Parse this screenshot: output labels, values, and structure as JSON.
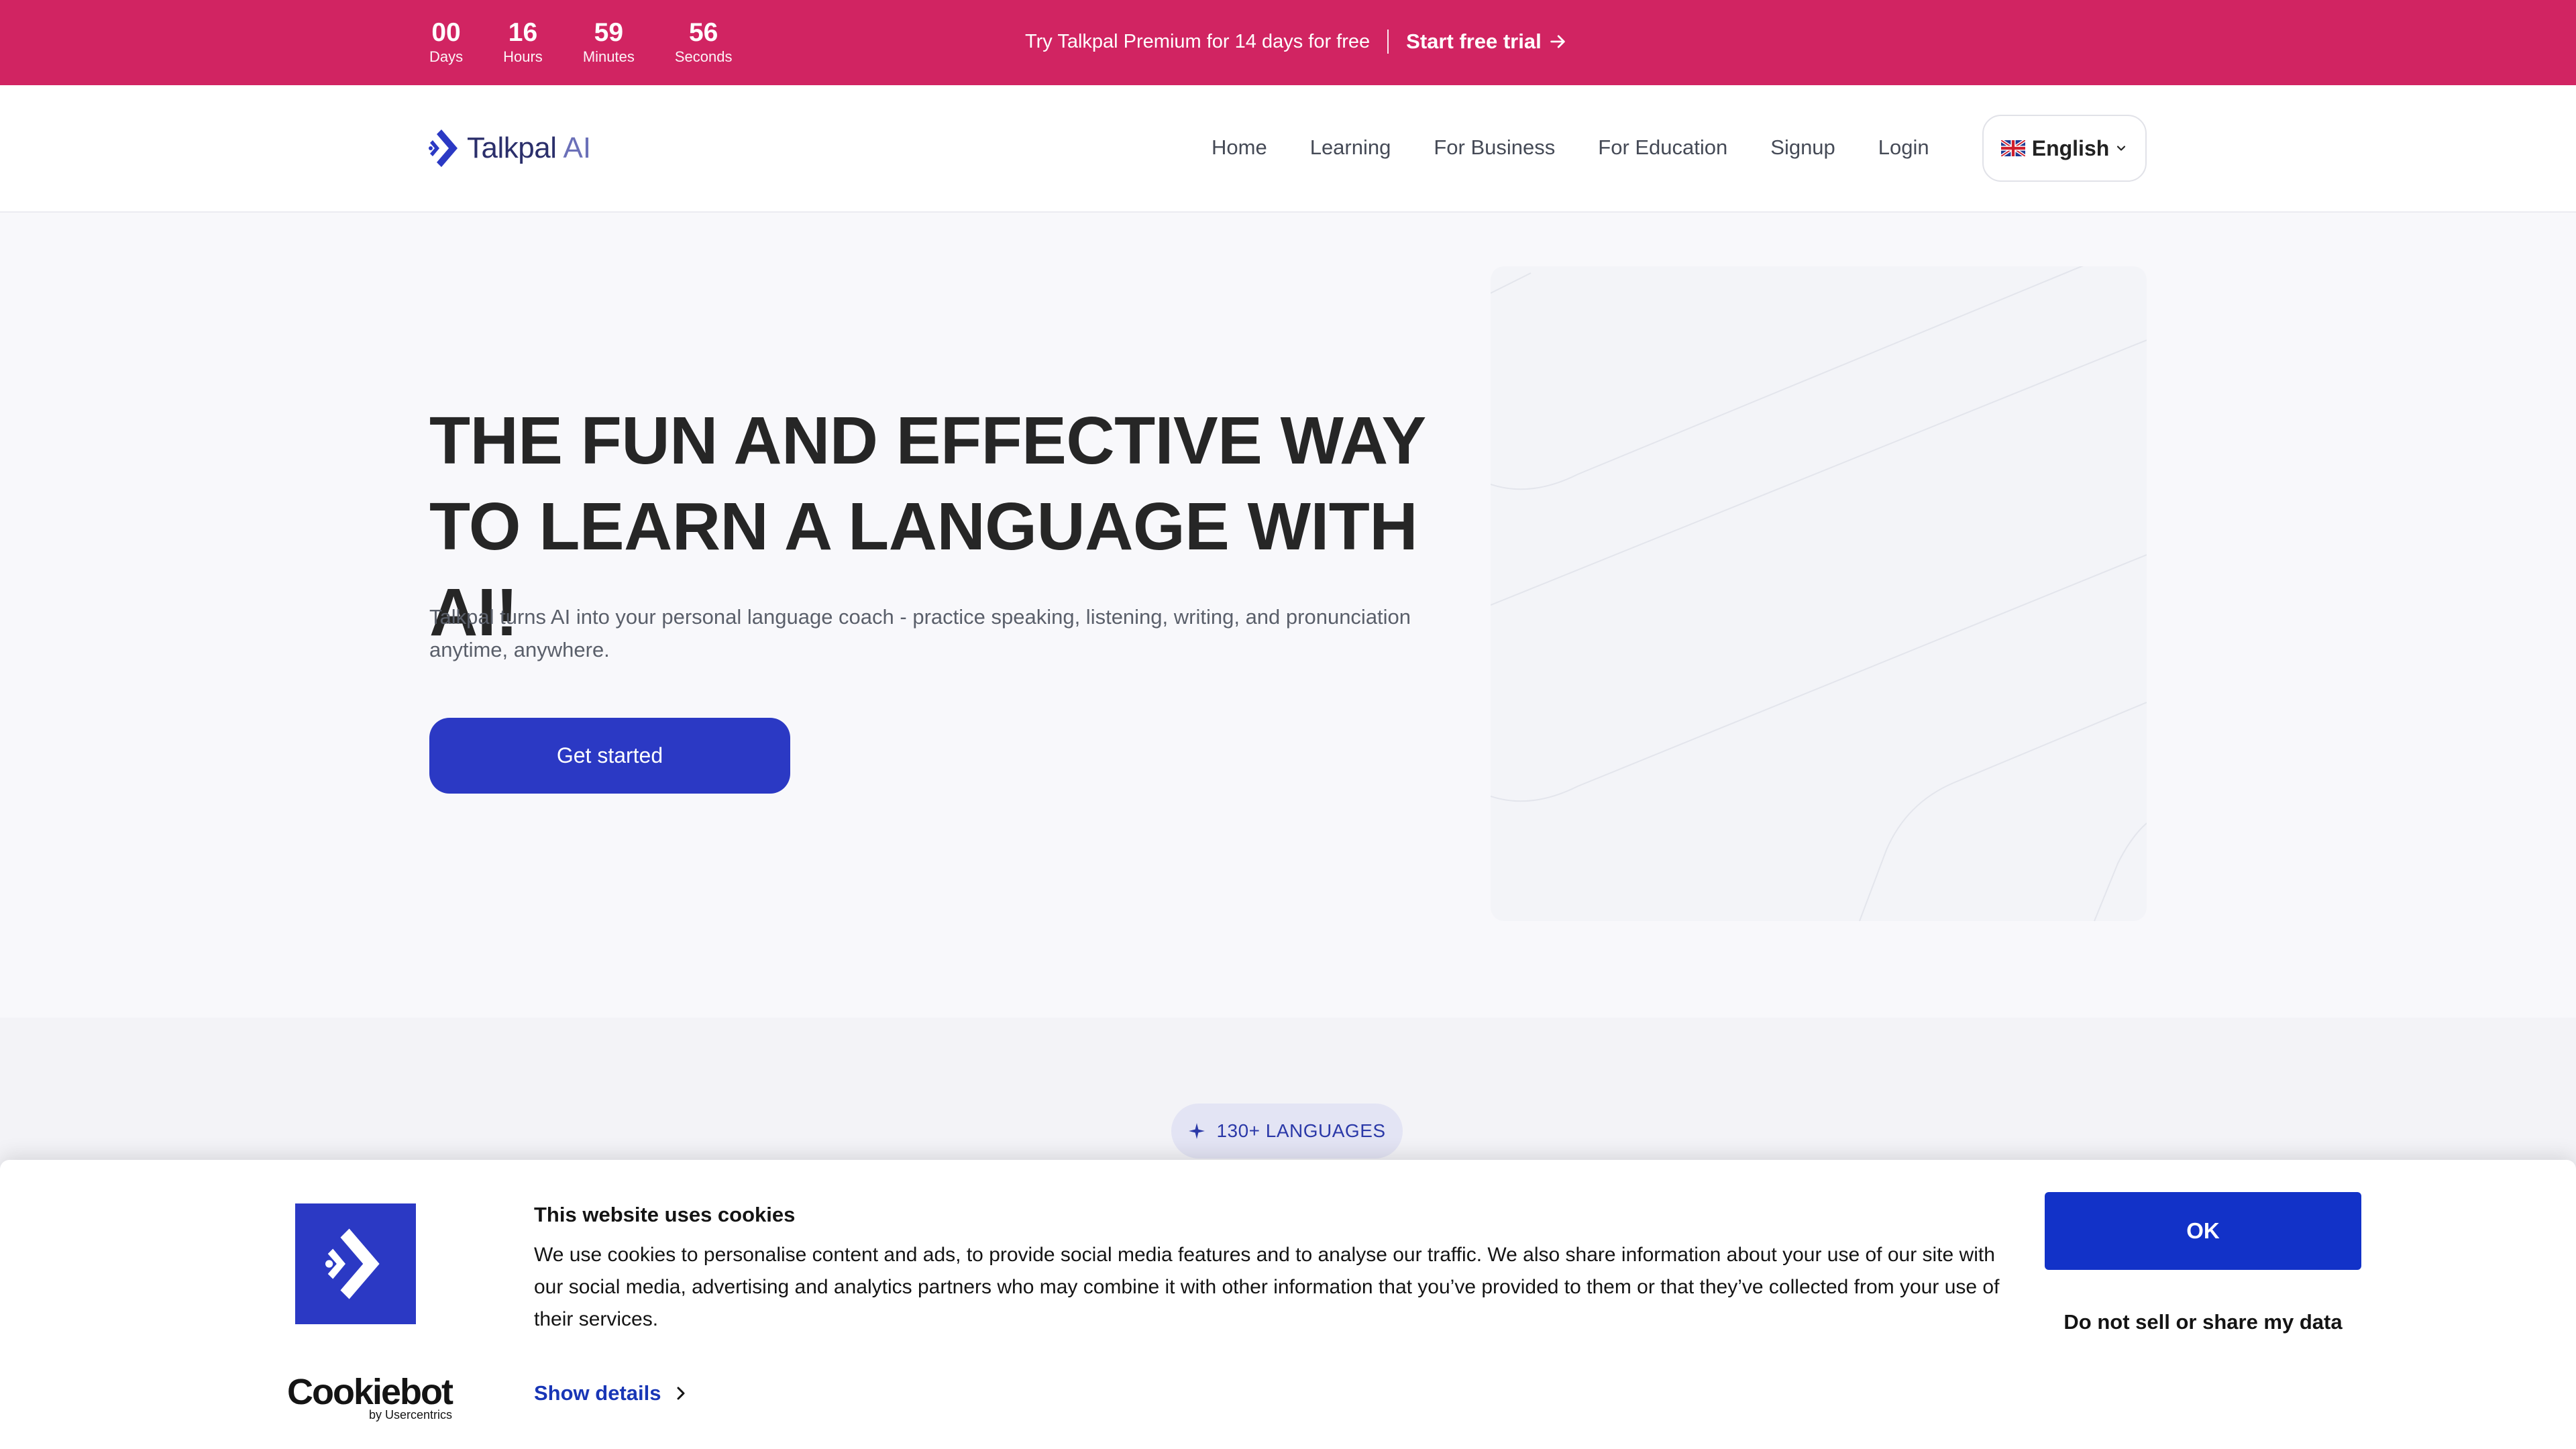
{
  "promo": {
    "countdown": [
      {
        "value": "00",
        "label": "Days"
      },
      {
        "value": "16",
        "label": "Hours"
      },
      {
        "value": "59",
        "label": "Minutes"
      },
      {
        "value": "56",
        "label": "Seconds"
      }
    ],
    "text": "Try Talkpal Premium for 14 days for free",
    "cta": "Start free trial",
    "bg_color": "#d12462"
  },
  "nav": {
    "logo_text": "Talkpal",
    "logo_suffix": "AI",
    "links": [
      "Home",
      "Learning",
      "For Business",
      "For Education",
      "Signup",
      "Login"
    ],
    "language": "English",
    "language_flag": "uk-flag-icon"
  },
  "hero": {
    "title": "THE FUN AND EFFECTIVE WAY TO LEARN A LANGUAGE WITH AI!",
    "subtitle": "Talkpal turns AI into your personal language coach - practice speaking, listening, writing, and pronunciation anytime, anywhere.",
    "cta": "Get started",
    "accent_color": "#2b39c4"
  },
  "languages": {
    "chip": "130+ LANGUAGES"
  },
  "cookie": {
    "title": "This website uses cookies",
    "text": "We use cookies to personalise content and ads, to provide social media features and to analyse our traffic. We also share information about your use of our site with our social media, advertising and analytics partners who may combine it with other information that you’ve provided to them or that they’ve collected from your use of their services.",
    "details": "Show details",
    "ok": "OK",
    "do_not_sell": "Do not sell or share my data",
    "brand": "Cookiebot",
    "brand_sub": "by Usercentrics",
    "ok_color": "#1232c8"
  }
}
